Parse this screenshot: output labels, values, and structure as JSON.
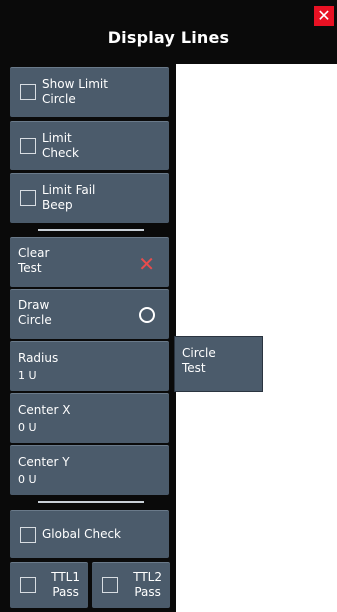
{
  "header": {
    "title": "Display Lines",
    "close_label": "✕"
  },
  "limits": {
    "show_limit_circle": "Show Limit\nCircle",
    "limit_check": "Limit\nCheck",
    "limit_fail_beep": "Limit Fail\nBeep"
  },
  "circle": {
    "clear_test": "Clear\nTest",
    "draw_circle": "Draw\nCircle",
    "radius_label": "Radius",
    "radius_value": "1 U",
    "center_x_label": "Center X",
    "center_x_value": "0 U",
    "center_y_label": "Center Y",
    "center_y_value": "0 U"
  },
  "popup": {
    "label": "Circle\nTest"
  },
  "global": {
    "global_check": "Global Check",
    "ttl1_pass": "TTL1\nPass",
    "ttl2_pass": "TTL2\nPass"
  },
  "colors": {
    "panel": "#0a0a0a",
    "button": "#4b5b6b",
    "close": "#e81123",
    "clear_x": "#e84c4c"
  }
}
